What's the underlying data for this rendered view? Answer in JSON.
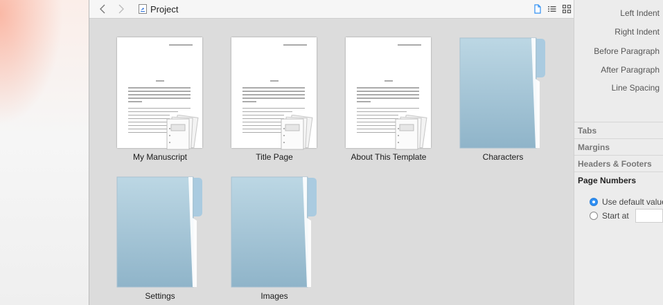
{
  "window": {
    "title": "Project",
    "nav": {
      "back_icon": "chevron-left-icon",
      "forward_icon": "chevron-right-icon"
    },
    "view_buttons": [
      "document-view-icon",
      "outline-view-icon",
      "grid-view-icon"
    ]
  },
  "items": [
    {
      "label": "My Manuscript",
      "kind": "document-stack"
    },
    {
      "label": "Title Page",
      "kind": "document-stack"
    },
    {
      "label": "About This Template",
      "kind": "document-stack"
    },
    {
      "label": "Characters",
      "kind": "folder"
    },
    {
      "label": "Settings",
      "kind": "folder"
    },
    {
      "label": "Images",
      "kind": "folder"
    }
  ],
  "inspector": {
    "spacing": {
      "left_indent": "Left Indent",
      "right_indent": "Right Indent",
      "before_paragraph": "Before Paragraph",
      "after_paragraph": "After Paragraph",
      "line_spacing": "Line Spacing"
    },
    "sections": [
      "Tabs",
      "Margins",
      "Headers & Footers",
      "Page Numbers"
    ],
    "page_numbers": {
      "use_default": "Use default value",
      "start_at": "Start at",
      "selected": "use_default",
      "start_at_value": ""
    }
  },
  "colors": {
    "accent": "#2f8ff3",
    "folder": "#9fc3d6",
    "window_bg": "#dcdcdc"
  }
}
